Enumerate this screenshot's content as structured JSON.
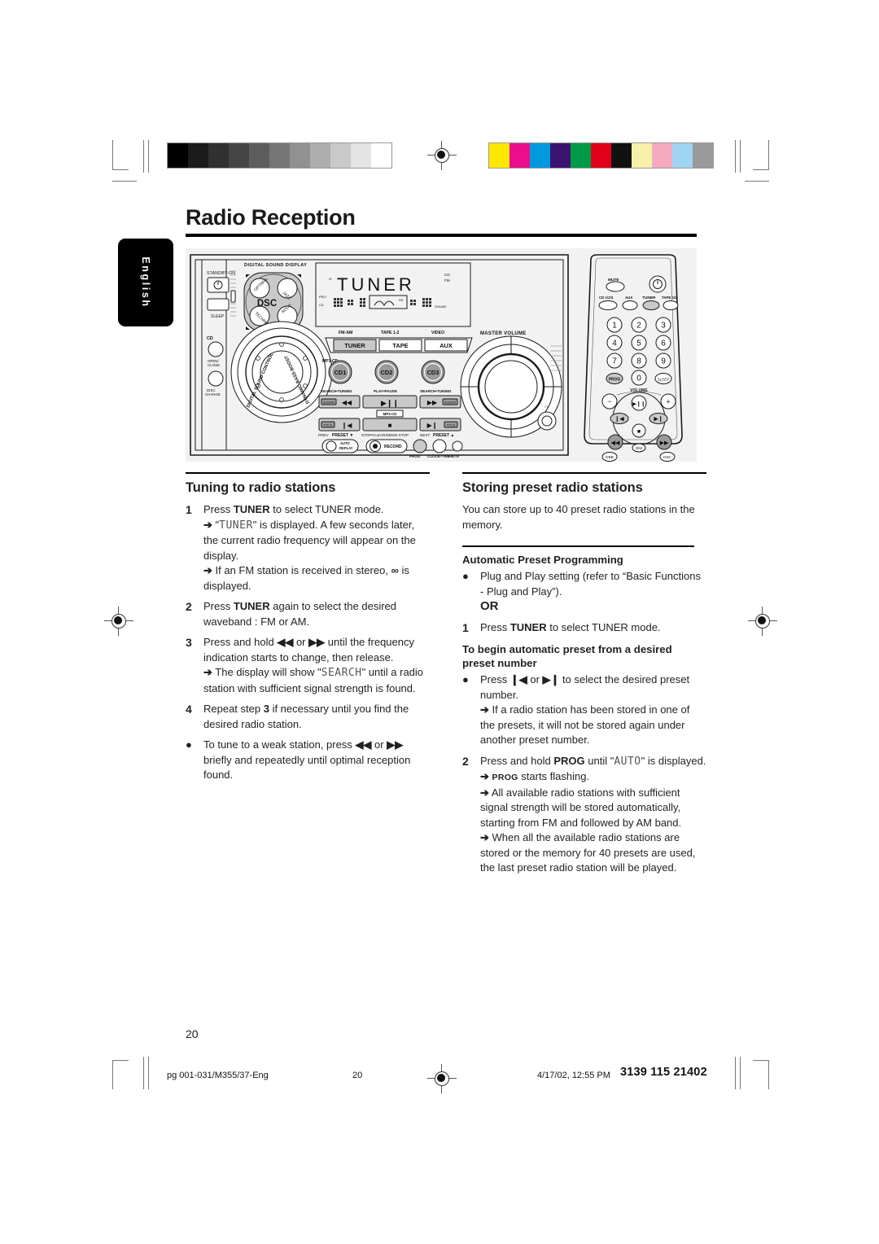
{
  "page": {
    "title": "Radio Reception",
    "language_tab": "English",
    "page_number": "20"
  },
  "footer": {
    "file": "pg 001-031/M355/37-Eng",
    "page": "20",
    "date": "4/17/02, 12:55 PM",
    "code": "3139 115 21402"
  },
  "illustration": {
    "alt_name": "philips-mini-hifi-system-and-remote",
    "unit_labels": {
      "standby_on": "STANDBY-ON",
      "sleep": "SLEEP",
      "digital_sound_display": "DIGITAL SOUND DISPLAY",
      "dsc": "DSC",
      "dsc_optimal": "OPTIMAL",
      "dsc_jazz": "JAZZ",
      "dsc_techno": "TECHNO",
      "dsc_rock": "ROCK",
      "display_text": "TUNER",
      "display_fm_am": "FM-AM",
      "display_tape": "TAPE 1-2",
      "display_video": "VIDEO",
      "source_tuner": "TUNER",
      "source_tape": "TAPE",
      "source_aux": "AUX",
      "master_volume": "MASTER VOLUME",
      "cd": "CD",
      "open_close": "OPEN/CLOSE",
      "disc_change": "DISC CHANGE",
      "dynamic_bass_boost": "DYNAMIC BASS BOOST",
      "digital_sound_control": "DIGITAL SOUND CONTROL",
      "mp3_cd": "MP3-CD",
      "cd1": "CD1",
      "cd2": "CD2",
      "cd3": "CD3",
      "search_tuning_left": "SEARCH•TUNING",
      "play_pause": "PLAY•PAUSE",
      "search_tuning_right": "SEARCH•TUNING",
      "album_left": "ALBUM",
      "album_right": "ALBUM",
      "title_left": "TITLE",
      "title_right": "TITLE",
      "prev_preset": "PREV PRESET",
      "stop_clear_demo": "STOP•CLEAR/DEMO STOP",
      "next_preset": "NEXT PRESET",
      "auto_replay": "AUTO REPLAY",
      "record": "RECORD",
      "prog": "PROG",
      "clock_timer": "CLOCK•TIMER",
      "dim": "DIM"
    },
    "remote_labels": {
      "mute": "MUTE",
      "standby": "STANDBY",
      "cd_123": "CD 1/2/3",
      "aux": "AUX",
      "tuner": "TUNER",
      "tape_12": "TAPE 1/2",
      "keys": [
        "1",
        "2",
        "3",
        "4",
        "5",
        "6",
        "7",
        "8",
        "9"
      ],
      "prog": "PROG",
      "zero": "0",
      "sleep": "SLEEP",
      "volume": "VOLUME",
      "minus": "−",
      "plus": "+",
      "dim": "DIM",
      "dbb": "DBB",
      "dsc": "DSC"
    }
  },
  "left_column": {
    "heading": "Tuning to radio stations",
    "steps": [
      {
        "marker": "1",
        "lines": [
          {
            "type": "plain_bold",
            "pre": "Press ",
            "bold": "TUNER",
            "post": " to select TUNER mode."
          },
          {
            "type": "arrow_lcd",
            "pre": "\"",
            "lcd": "TUNER",
            "post": "\" is displayed.  A few seconds later, the current radio frequency will appear on the display."
          },
          {
            "type": "arrow",
            "text": "If an FM station is received in stereo, ∞ is displayed."
          }
        ]
      },
      {
        "marker": "2",
        "lines": [
          {
            "type": "plain_bold",
            "pre": "Press ",
            "bold": "TUNER",
            "post": " again to select the desired waveband : FM or AM."
          }
        ]
      },
      {
        "marker": "3",
        "lines": [
          {
            "type": "plain",
            "text": "Press and hold ◀◀ or ▶▶ until the frequency indication starts to change, then release."
          },
          {
            "type": "arrow_lcd",
            "pre": "The display will show \"",
            "lcd": "SEARCH",
            "post": "\" until a radio station with sufficient signal strength is found."
          }
        ]
      },
      {
        "marker": "4",
        "lines": [
          {
            "type": "plain_bold",
            "pre": "Repeat step ",
            "bold": "3",
            "post": " if necessary until you find the desired radio station."
          }
        ]
      },
      {
        "marker": "●",
        "lines": [
          {
            "type": "plain",
            "text": "To tune to a weak station, press ◀◀ or ▶▶ briefly and repeatedly until optimal reception found."
          }
        ]
      }
    ]
  },
  "right_column": {
    "heading": "Storing preset radio stations",
    "intro": "You can store up to 40 preset radio stations in the memory.",
    "subheading_1": "Automatic Preset Programming",
    "items_1": [
      {
        "marker": "●",
        "lines": [
          {
            "type": "plain",
            "text": "Plug and Play setting (refer to “Basic Functions - Plug and Play”)."
          },
          {
            "type": "or",
            "text": "OR"
          }
        ]
      },
      {
        "marker": "1",
        "lines": [
          {
            "type": "plain_bold",
            "pre": "Press ",
            "bold": "TUNER",
            "post": " to select TUNER mode."
          }
        ]
      }
    ],
    "subheading_2": "To begin automatic preset from a desired preset number",
    "items_2": [
      {
        "marker": "●",
        "lines": [
          {
            "type": "plain",
            "text": "Press ◀▌ or ▌▶ to select the desired preset number."
          },
          {
            "type": "arrow",
            "text": "If a radio station has been stored in one of the presets, it will not be stored again under another preset number."
          }
        ]
      },
      {
        "marker": "2",
        "lines": [
          {
            "type": "plain_bold_lcd",
            "pre": "Press and hold ",
            "bold": "PROG",
            "mid": " until \"",
            "lcd": "AUTO",
            "post": "\" is displayed."
          },
          {
            "type": "arrow_smallcaps",
            "caps": "PROG",
            "text": " starts flashing."
          },
          {
            "type": "arrow",
            "text": "All available radio stations with sufficient signal strength will be stored automatically, starting from FM and followed by AM band."
          },
          {
            "type": "arrow",
            "text": "When all the available radio stations are stored or the memory for 40 presets are used, the last preset radio station will be played."
          }
        ]
      }
    ]
  },
  "colors": {
    "gray_scale": [
      "#000000",
      "#1b1b1b",
      "#303030",
      "#454545",
      "#5d5d5d",
      "#767676",
      "#919191",
      "#adadad",
      "#c9c9c9",
      "#e4e4e4",
      "#ffffff"
    ],
    "color_patches": [
      "#ffe800",
      "#ec0c8e",
      "#0099db",
      "#3d1372",
      "#009b48",
      "#e1001a",
      "#111111",
      "#f7f0a8",
      "#f4a9c0",
      "#9fd4f2",
      "#9a9a9a"
    ]
  }
}
